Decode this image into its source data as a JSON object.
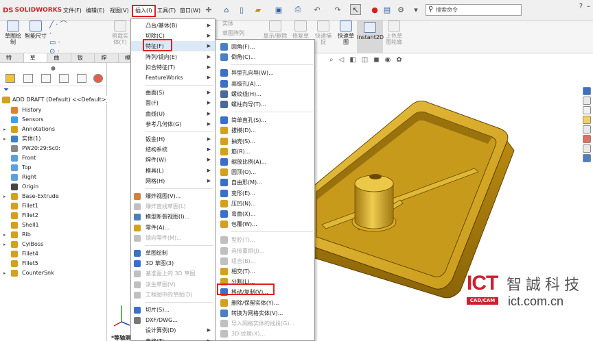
{
  "app": {
    "logo": "SOLIDWORKS",
    "logo_mark": "DS"
  },
  "menubar": [
    "文件(F)",
    "编辑(E)",
    "视图(V)",
    "插入(I)",
    "工具(T)",
    "窗口(W)"
  ],
  "search": {
    "placeholder": "搜索命令"
  },
  "ribbon": {
    "sketch": "草图绘制",
    "smart_dim": "智能尺寸",
    "cut_entity": "剪裁实体(T)",
    "solid": "实体",
    "sketch_array": "草图阵列",
    "show_delete": "显示/删除几何关系",
    "repair": "修复草图",
    "quick_snap": "快速捕捉",
    "quick_sketch": "快速草图",
    "instant2d": "Instant2D",
    "shaded": "上色草图轮廓"
  },
  "tabs": [
    "特征",
    "草图",
    "曲面",
    "钣金",
    "焊件",
    "模"
  ],
  "tree": {
    "root": "ADD DRAFT (Default) <<Default>_Dis",
    "items": [
      {
        "label": "History",
        "arrow": ""
      },
      {
        "label": "Sensors",
        "arrow": ""
      },
      {
        "label": "Annotations",
        "arrow": "▸"
      },
      {
        "label": "实体(1)",
        "arrow": "▸"
      },
      {
        "label": "PW20:29:Sc0:",
        "arrow": ""
      },
      {
        "label": "Front",
        "arrow": ""
      },
      {
        "label": "Top",
        "arrow": ""
      },
      {
        "label": "Right",
        "arrow": ""
      },
      {
        "label": "Origin",
        "arrow": ""
      },
      {
        "label": "Base-Extrude",
        "arrow": "▸"
      },
      {
        "label": "Fillet1",
        "arrow": ""
      },
      {
        "label": "Fillet2",
        "arrow": ""
      },
      {
        "label": "Shell1",
        "arrow": ""
      },
      {
        "label": "Rib",
        "arrow": "▸"
      },
      {
        "label": "CylBoss",
        "arrow": "▸"
      },
      {
        "label": "Fillet4",
        "arrow": ""
      },
      {
        "label": "Fillet5",
        "arrow": ""
      },
      {
        "label": "CounterSnk",
        "arrow": "▸"
      }
    ]
  },
  "insert_menu": [
    {
      "label": "凸台/基体(B)",
      "sub": true,
      "dim": false
    },
    {
      "label": "切除(C)",
      "sub": true,
      "dim": false
    },
    {
      "label": "特征(F)",
      "sub": true,
      "dim": false
    },
    {
      "label": "阵列/镜向(E)",
      "sub": true,
      "dim": false
    },
    {
      "label": "扣合特征(T)",
      "sub": true,
      "dim": false
    },
    {
      "label": "FeatureWorks",
      "sub": true,
      "dim": false
    },
    {
      "label": "曲面(S)",
      "sub": true,
      "dim": false
    },
    {
      "label": "面(F)",
      "sub": true,
      "dim": false
    },
    {
      "label": "曲线(U)",
      "sub": true,
      "dim": false
    },
    {
      "label": "参考几何体(G)",
      "sub": true,
      "dim": false
    },
    {
      "label": "钣金(H)",
      "sub": true,
      "dim": false
    },
    {
      "label": "结构系统",
      "sub": true,
      "dim": false
    },
    {
      "label": "焊件(W)",
      "sub": true,
      "dim": false
    },
    {
      "label": "模具(L)",
      "sub": true,
      "dim": false
    },
    {
      "label": "网格(H)",
      "sub": true,
      "dim": false
    },
    {
      "label": "爆炸视图(V)...",
      "sub": false,
      "dim": false
    },
    {
      "label": "爆炸直线草图(L)",
      "sub": false,
      "dim": true
    },
    {
      "label": "模型断裂视图(I)...",
      "sub": false,
      "dim": false
    },
    {
      "label": "零件(A)...",
      "sub": false,
      "dim": false
    },
    {
      "label": "镜向零件(M)...",
      "sub": false,
      "dim": true
    },
    {
      "label": "草图绘制",
      "sub": false,
      "dim": false
    },
    {
      "label": "3D 草图(3)",
      "sub": false,
      "dim": false
    },
    {
      "label": "基准面上的 3D 草图",
      "sub": false,
      "dim": true
    },
    {
      "label": "派生草图(V)",
      "sub": false,
      "dim": true
    },
    {
      "label": "工程图中的草图(D)",
      "sub": false,
      "dim": true
    },
    {
      "label": "切片(S)...",
      "sub": false,
      "dim": false
    },
    {
      "label": "DXF/DWG...",
      "sub": false,
      "dim": false
    },
    {
      "label": "设计算例(D)",
      "sub": true,
      "dim": false
    },
    {
      "label": "表格(T)",
      "sub": true,
      "dim": false
    }
  ],
  "sub_menu": [
    {
      "label": "圆角(F)...",
      "dim": false
    },
    {
      "label": "倒角(C)...",
      "dim": false
    },
    {
      "label": "异型孔向导(W)...",
      "dim": false
    },
    {
      "label": "高级孔(A)...",
      "dim": false
    },
    {
      "label": "螺纹线(H)...",
      "dim": false
    },
    {
      "label": "螺柱向导(T)...",
      "dim": false
    },
    {
      "label": "简单直孔(S)...",
      "dim": false
    },
    {
      "label": "拔模(D)...",
      "dim": false
    },
    {
      "label": "抽壳(S)...",
      "dim": false
    },
    {
      "label": "筋(R)...",
      "dim": false
    },
    {
      "label": "缩放比例(A)...",
      "dim": false
    },
    {
      "label": "圆顶(O)...",
      "dim": false
    },
    {
      "label": "自由形(M)...",
      "dim": false
    },
    {
      "label": "变形(E)...",
      "dim": false
    },
    {
      "label": "压凹(N)...",
      "dim": false
    },
    {
      "label": "弯曲(X)...",
      "dim": false
    },
    {
      "label": "包覆(W)...",
      "dim": false
    },
    {
      "label": "型腔(T)...",
      "dim": true
    },
    {
      "label": "连接重组(J)...",
      "dim": true
    },
    {
      "label": "组合(B)...",
      "dim": true
    },
    {
      "label": "相交(T)...",
      "dim": false
    },
    {
      "label": "分割(L)...",
      "dim": false
    },
    {
      "label": "移动/复制(V)...",
      "dim": false
    },
    {
      "label": "删除/保留实体(Y)...",
      "dim": false
    },
    {
      "label": "转换为网格实体(V)...",
      "dim": false
    },
    {
      "label": "导入网格实体的线段(G)...",
      "dim": true
    },
    {
      "label": "3D 纹理(X)...",
      "dim": true
    }
  ],
  "view_label": "*等轴测",
  "watermark": {
    "ict": "ICT",
    "sub": "CAD/CAM",
    "cn": "智誠科技",
    "url": "ict.com.cn"
  },
  "colors": {
    "part_gold": "#d4a017",
    "highlight_red": "#e02020",
    "accent_blue": "#2a5aa8"
  }
}
